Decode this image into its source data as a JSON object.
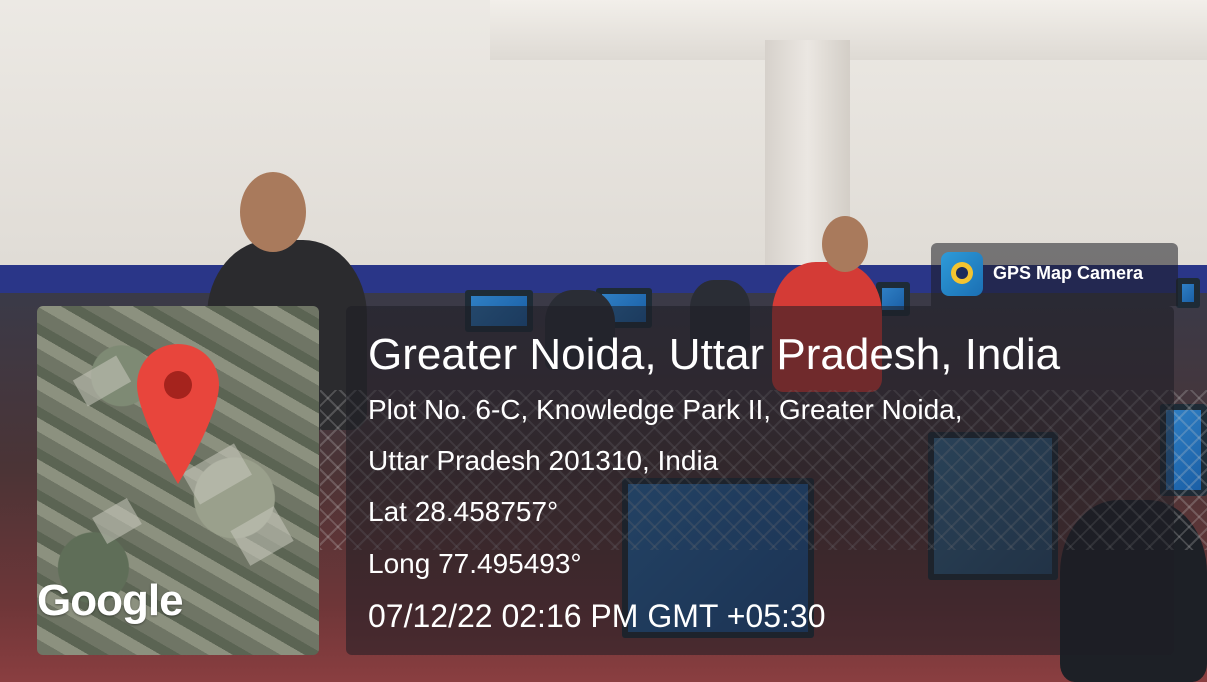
{
  "overlay": {
    "app_badge": "GPS Map Camera",
    "location_title": "Greater Noida, Uttar Pradesh, India",
    "address_line1": "Plot No. 6-C, Knowledge Park II, Greater Noida,",
    "address_line2": "Uttar Pradesh 201310, India",
    "latitude": "Lat 28.458757°",
    "longitude": "Long 77.495493°",
    "timestamp": "07/12/22 02:16 PM GMT +05:30",
    "map_attribution": "Google"
  },
  "colors": {
    "pin_red": "#e8453c",
    "pin_dark": "#a5231d",
    "overlay_bg": "rgba(30,30,36,0.55)",
    "wall_stripe": "#2a3688"
  },
  "icons": {
    "map_pin": "map-pin-icon",
    "camera": "gps-map-camera-icon"
  }
}
